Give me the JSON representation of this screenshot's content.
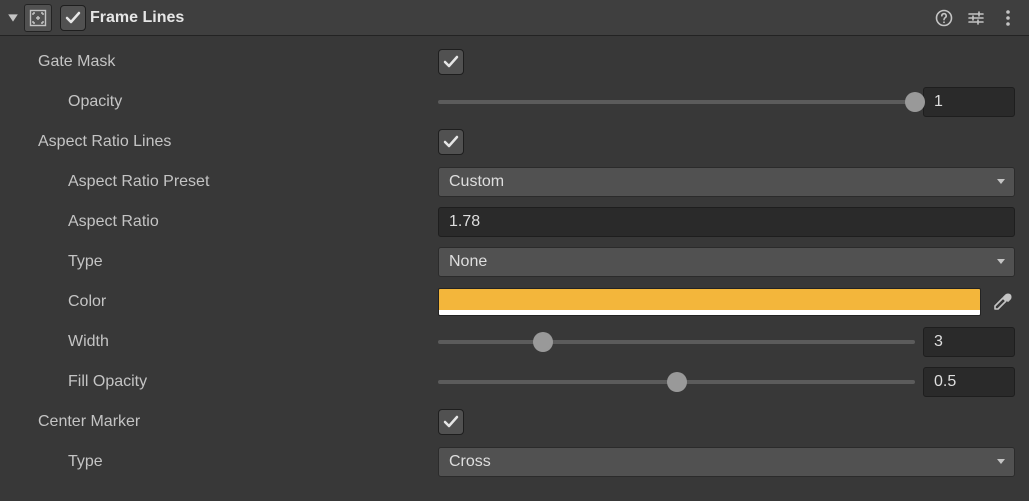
{
  "header": {
    "title": "Frame Lines",
    "enabled": true
  },
  "fields": {
    "gateMask": {
      "label": "Gate Mask",
      "checked": true,
      "opacity": {
        "label": "Opacity",
        "value": "1",
        "thumbPct": 100
      }
    },
    "aspect": {
      "label": "Aspect Ratio Lines",
      "checked": true,
      "preset": {
        "label": "Aspect Ratio Preset",
        "value": "Custom"
      },
      "ratio": {
        "label": "Aspect Ratio",
        "value": "1.78"
      },
      "type": {
        "label": "Type",
        "value": "None"
      },
      "color": {
        "label": "Color",
        "hex": "#f3b63b"
      },
      "width": {
        "label": "Width",
        "value": "3",
        "thumbPct": 22
      },
      "fillOp": {
        "label": "Fill Opacity",
        "value": "0.5",
        "thumbPct": 50
      }
    },
    "center": {
      "label": "Center Marker",
      "checked": true,
      "type": {
        "label": "Type",
        "value": "Cross"
      }
    }
  }
}
